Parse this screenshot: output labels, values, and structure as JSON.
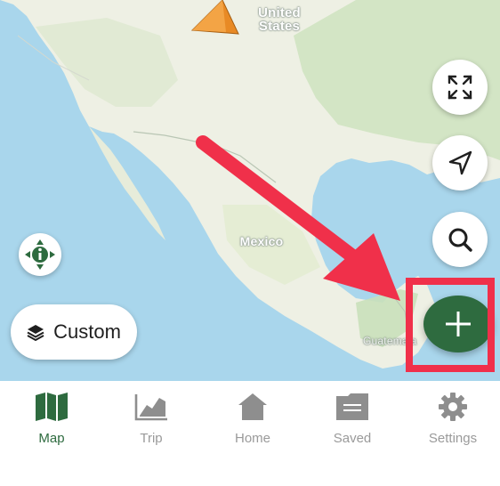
{
  "map": {
    "country_labels": {
      "united_states": "United\nStates",
      "mexico": "Mexico",
      "guatemala": "Guatemala"
    },
    "colors": {
      "water": "#a9d6ec",
      "land": "#eef0e4",
      "forest": "#cfe3c1",
      "accent_green": "#2e6b3f",
      "annotation_red": "#f0304a",
      "marker_orange": "#e88a25"
    }
  },
  "controls": {
    "expand_icon": "expand-icon",
    "locate_icon": "navigation-arrow-icon",
    "search_icon": "search-icon",
    "compass_icon": "compass-info-icon",
    "add_icon": "plus-icon",
    "layers": {
      "icon": "layers-icon",
      "label": "Custom"
    }
  },
  "tabbar": {
    "tabs": [
      {
        "key": "map",
        "label": "Map",
        "icon": "map-icon",
        "active": true
      },
      {
        "key": "trip",
        "label": "Trip",
        "icon": "chart-icon",
        "active": false
      },
      {
        "key": "home",
        "label": "Home",
        "icon": "home-icon",
        "active": false
      },
      {
        "key": "saved",
        "label": "Saved",
        "icon": "folder-icon",
        "active": false
      },
      {
        "key": "settings",
        "label": "Settings",
        "icon": "gear-icon",
        "active": false
      }
    ]
  }
}
